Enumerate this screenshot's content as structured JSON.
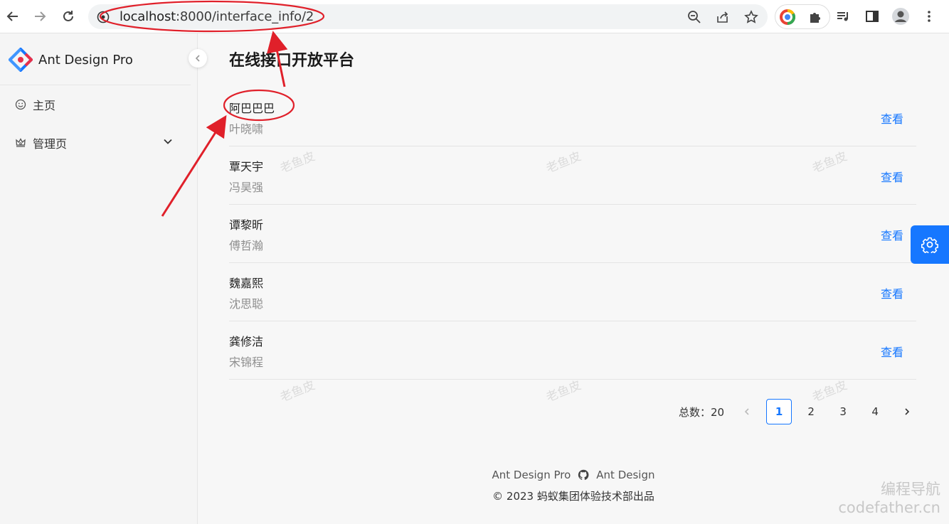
{
  "browser": {
    "url_host": "localhost",
    "url_rest": ":8000/interface_info/2"
  },
  "sidebar": {
    "app_title": "Ant Design Pro",
    "items": [
      {
        "label": "主页",
        "icon": "smile-icon"
      },
      {
        "label": "管理页",
        "icon": "crown-icon"
      }
    ]
  },
  "main": {
    "title": "在线接口开放平台",
    "list": [
      {
        "title": "阿巴巴巴",
        "description": "叶晓啸",
        "action": "查看"
      },
      {
        "title": "覃天宇",
        "description": "冯昊强",
        "action": "查看"
      },
      {
        "title": "谭黎昕",
        "description": "傅哲瀚",
        "action": "查看"
      },
      {
        "title": "魏嘉熙",
        "description": "沈思聪",
        "action": "查看"
      },
      {
        "title": "龚修洁",
        "description": "宋锦程",
        "action": "查看"
      }
    ],
    "pagination": {
      "total_label": "总数：20",
      "pages": [
        "1",
        "2",
        "3",
        "4"
      ],
      "current": "1"
    }
  },
  "footer": {
    "link1": "Ant Design Pro",
    "link2": "Ant Design",
    "copyright": "© 2023 蚂蚁集团体验技术部出品"
  },
  "watermark": "老鱼皮",
  "corner_watermark": {
    "line1": "编程导航",
    "line2": "codefather.cn"
  },
  "colors": {
    "primary": "#1677ff",
    "annotation": "#e0202a"
  }
}
